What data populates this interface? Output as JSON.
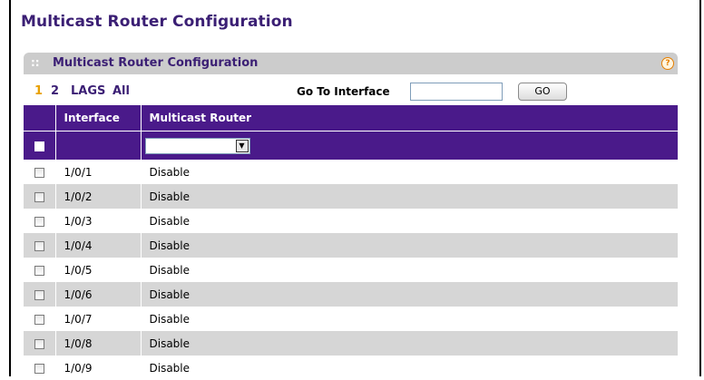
{
  "page": {
    "title": "Multicast Router Configuration"
  },
  "panel": {
    "title": "Multicast Router Configuration",
    "dots": "::",
    "help": "?"
  },
  "nav": {
    "links": [
      "1",
      "2",
      "LAGS",
      "All"
    ],
    "goto_label": "Go To Interface",
    "goto_value": "",
    "go_button": "GO"
  },
  "table": {
    "headers": [
      "",
      "Interface",
      "Multicast Router"
    ],
    "filter_select_value": "",
    "rows": [
      {
        "interface": "1/0/1",
        "router": "Disable"
      },
      {
        "interface": "1/0/2",
        "router": "Disable"
      },
      {
        "interface": "1/0/3",
        "router": "Disable"
      },
      {
        "interface": "1/0/4",
        "router": "Disable"
      },
      {
        "interface": "1/0/5",
        "router": "Disable"
      },
      {
        "interface": "1/0/6",
        "router": "Disable"
      },
      {
        "interface": "1/0/7",
        "router": "Disable"
      },
      {
        "interface": "1/0/8",
        "router": "Disable"
      },
      {
        "interface": "1/0/9",
        "router": "Disable"
      }
    ]
  },
  "colors": {
    "accent": "#3b1f74",
    "header_bg": "#4a1a8a",
    "active_link": "#e8a000",
    "stripe": "#d6d6d6"
  }
}
